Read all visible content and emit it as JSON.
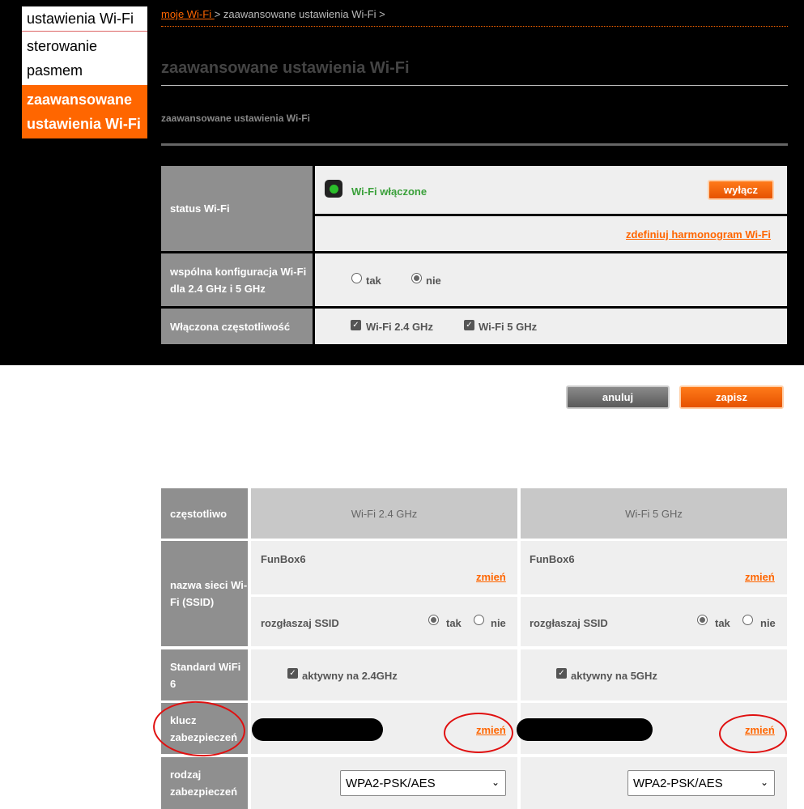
{
  "sidebar": {
    "items": [
      {
        "label": "ustawienia Wi-Fi"
      },
      {
        "label": "sterowanie pasmem"
      },
      {
        "label": "zaawansowane ustawienia Wi-Fi"
      }
    ]
  },
  "breadcrumb": {
    "link": "moje Wi-Fi ",
    "current": "> zaawansowane ustawienia Wi-Fi >"
  },
  "page": {
    "title": "zaawansowane ustawienia Wi-Fi",
    "subtitle": "zaawansowane ustawienia Wi-Fi"
  },
  "status": {
    "label": "status Wi-Fi",
    "state_text": "Wi-Fi włączone",
    "off_button": "wyłącz",
    "schedule_link": "zdefiniuj harmonogram Wi-Fi",
    "state_color": "#2bbf2b"
  },
  "common_config": {
    "label": "wspólna konfiguracja Wi-Fi dla 2.4 GHz i 5 GHz",
    "options": [
      "tak",
      "nie"
    ],
    "selected": "nie"
  },
  "enabled_freq": {
    "label": "Włączona częstotliwość",
    "options": [
      {
        "label": "Wi-Fi 2.4 GHz",
        "checked": true
      },
      {
        "label": "Wi-Fi 5 GHz",
        "checked": true
      }
    ]
  },
  "actions": {
    "cancel": "anuluj",
    "save": "zapisz"
  },
  "bands": {
    "freq_label": "częstotliwo",
    "columns": [
      "Wi-Fi 2.4 GHz",
      "Wi-Fi 5 GHz"
    ],
    "ssid_label": "nazwa sieci Wi-Fi (SSID)",
    "ssid_values": [
      "FunBox6",
      "FunBox6"
    ],
    "change": "zmień",
    "broadcast_label": "rozgłaszaj SSID",
    "yes": "tak",
    "no": "nie",
    "wifi6_label": "Standard WiFi 6",
    "wifi6_values": [
      "aktywny na 2.4GHz",
      "aktywny na 5GHz"
    ],
    "key_label": "klucz zabezpieczeń",
    "security_label": "rodzaj zabezpieczeń",
    "security_values": [
      "WPA2-PSK/AES",
      "WPA2-PSK/AES"
    ]
  },
  "colors": {
    "accent": "#ff6600",
    "label_bg": "#8f8f8f",
    "annotation": "#e01010"
  }
}
